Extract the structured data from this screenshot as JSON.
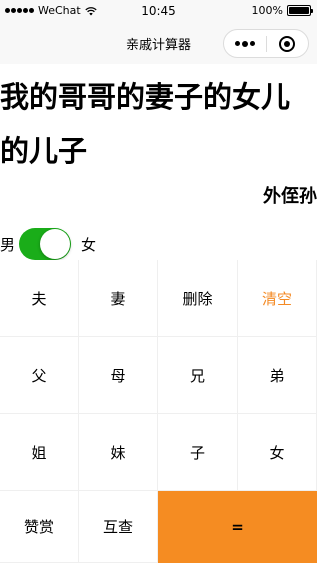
{
  "status_bar": {
    "carrier": "WeChat",
    "time": "10:45",
    "battery": "100%"
  },
  "nav": {
    "title": "亲戚计算器"
  },
  "expression": "我的哥哥的妻子的女儿的儿子",
  "result": "外侄孙",
  "gender": {
    "male_label": "男",
    "female_label": "女",
    "toggle_on": true
  },
  "keypad": {
    "keys": [
      "夫",
      "妻",
      "删除",
      "清空",
      "父",
      "母",
      "兄",
      "弟",
      "姐",
      "妹",
      "子",
      "女",
      "赞赏",
      "互查",
      "="
    ]
  },
  "colors": {
    "accent": "#f58c22",
    "toggle_green": "#1aad19",
    "clear_text": "#f48a24"
  }
}
